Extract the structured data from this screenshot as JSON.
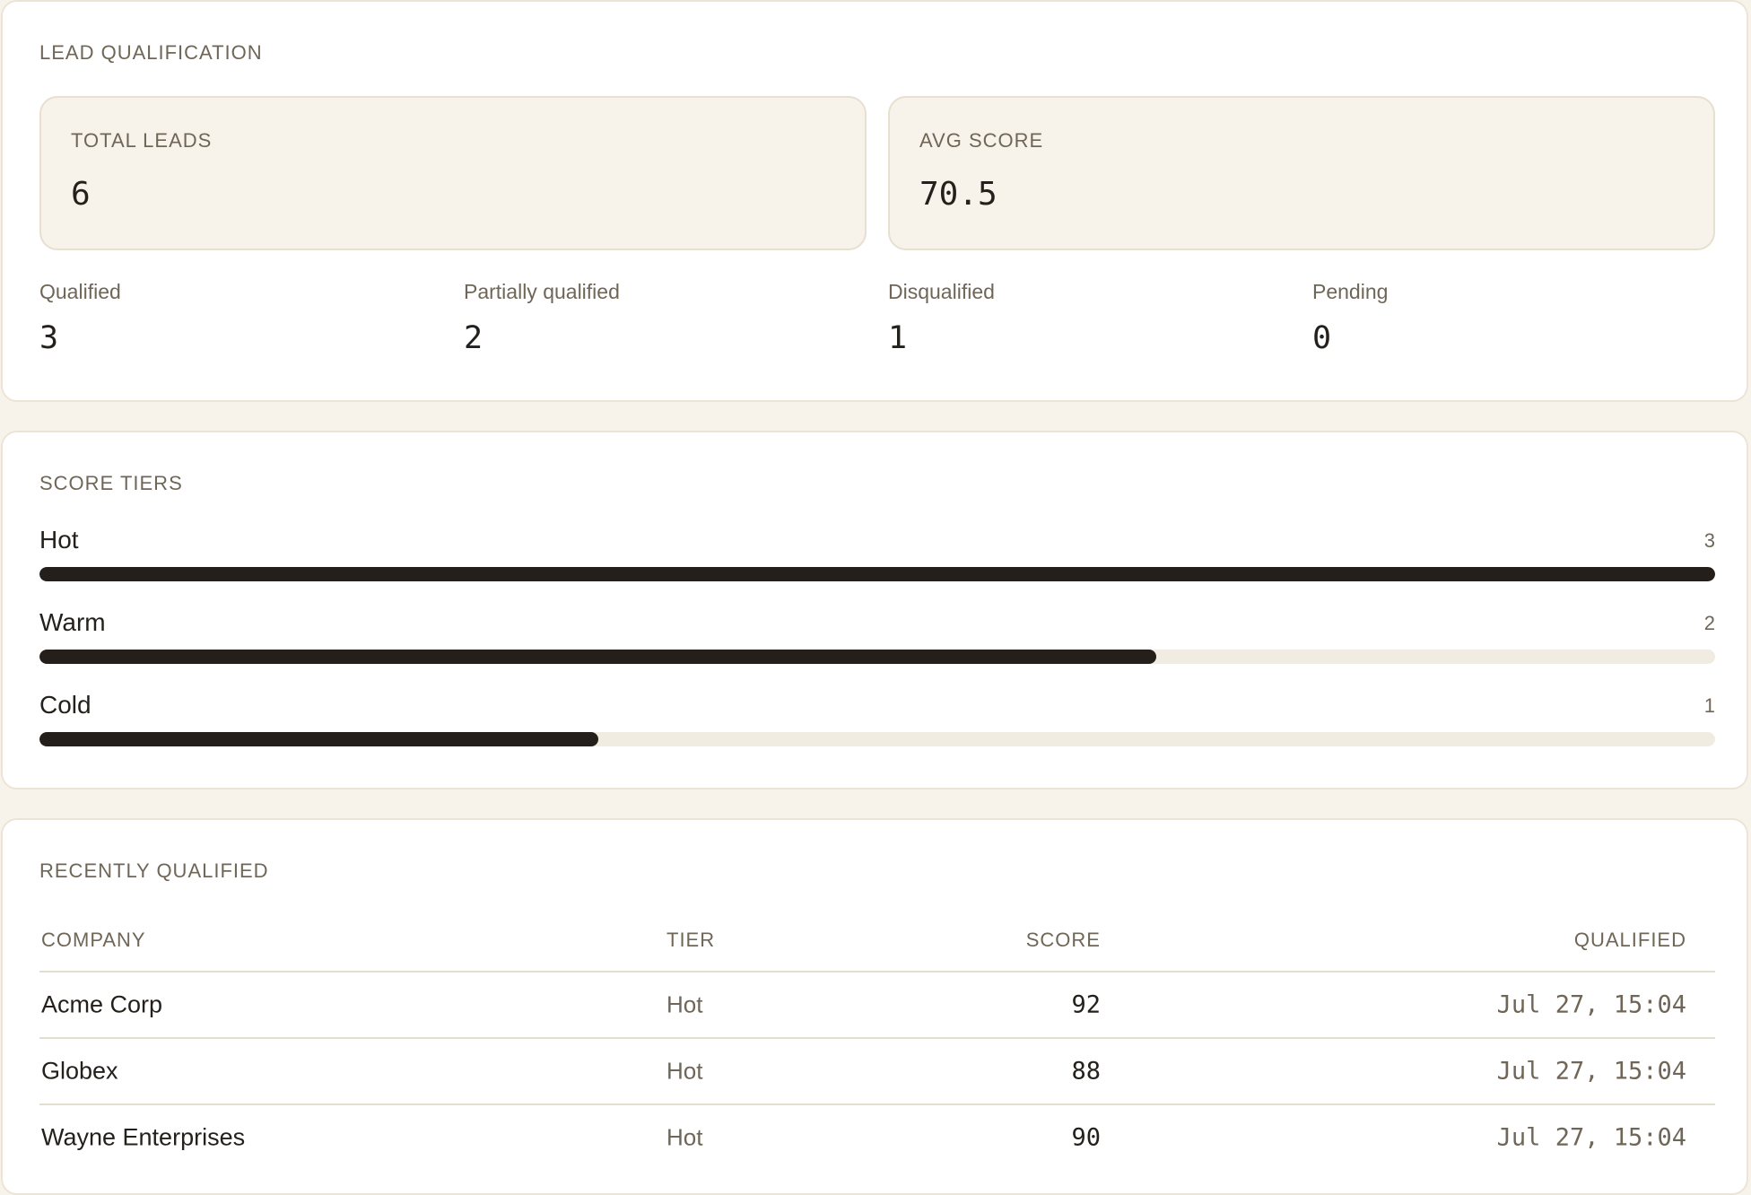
{
  "overview": {
    "title": "LEAD QUALIFICATION",
    "kpis": [
      {
        "label": "TOTAL LEADS",
        "value": "6"
      },
      {
        "label": "AVG SCORE",
        "value": "70.5"
      }
    ],
    "stats": [
      {
        "label": "Qualified",
        "value": "3"
      },
      {
        "label": "Partially qualified",
        "value": "2"
      },
      {
        "label": "Disqualified",
        "value": "1"
      },
      {
        "label": "Pending",
        "value": "0"
      }
    ]
  },
  "tiers": {
    "title": "SCORE TIERS",
    "items": [
      {
        "name": "Hot",
        "count": "3",
        "fraction": 1.0
      },
      {
        "name": "Warm",
        "count": "2",
        "fraction": 0.6667
      },
      {
        "name": "Cold",
        "count": "1",
        "fraction": 0.3333
      }
    ]
  },
  "recent": {
    "title": "RECENTLY QUALIFIED",
    "columns": {
      "company": "COMPANY",
      "tier": "TIER",
      "score": "SCORE",
      "qualified": "QUALIFIED"
    },
    "rows": [
      {
        "company": "Acme Corp",
        "tier": "Hot",
        "score": "92",
        "qualified": "Jul 27, 15:04"
      },
      {
        "company": "Globex",
        "tier": "Hot",
        "score": "88",
        "qualified": "Jul 27, 15:04"
      },
      {
        "company": "Wayne Enterprises",
        "tier": "Hot",
        "score": "90",
        "qualified": "Jul 27, 15:04"
      }
    ]
  },
  "colors": {
    "background": "#f7f3eb",
    "card": "#ffffff",
    "bar_fill": "#241f1a",
    "bar_track": "#f1ece2",
    "muted_text": "#6f6657"
  }
}
